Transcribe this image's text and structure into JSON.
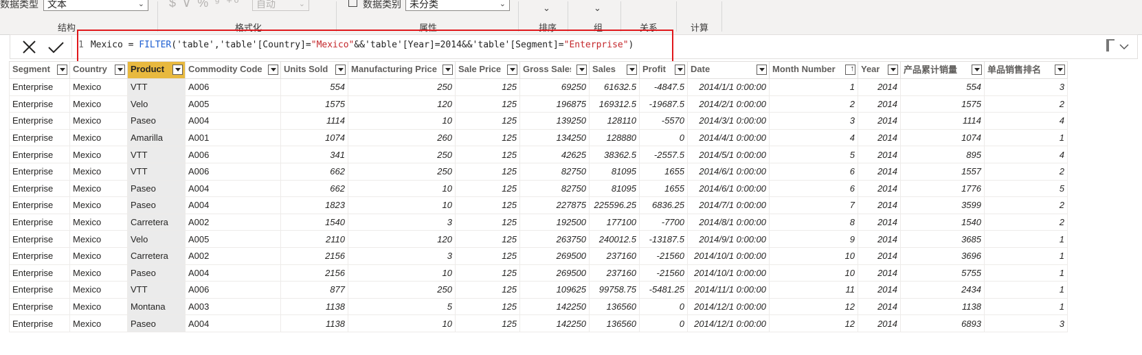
{
  "ribbon": {
    "data_type_label": "数据类型",
    "data_type_value": "文本",
    "group_structure": "结构",
    "format_symbols": "$ ∨ % ⁹ ⁺⁰",
    "format_select_value": "自动",
    "group_format": "格式化",
    "data_category_label": "数据类别",
    "data_category_value": "未分类",
    "group_properties": "属性",
    "group_sort": "排序",
    "group_group": "组",
    "group_relationships": "关系",
    "group_calculations": "计算"
  },
  "formula_bar": {
    "line_number": "1",
    "p1": "Mexico = ",
    "fn": "FILTER",
    "p2": "('table','table'[Country]=",
    "s1": "\"Mexico\"",
    "p3": "&&'table'[Year]=2014&&'table'[Segment]=",
    "s2": "\"Enterprise\"",
    "p4": ")"
  },
  "table": {
    "columns": [
      "Segment",
      "Country",
      "Product",
      "Commodity Code",
      "Units Sold",
      "Manufacturing Price",
      "Sale Price",
      "Gross Sales",
      "Sales",
      "Profit",
      "Date",
      "Month Number",
      "Year",
      "产品累计销量",
      "单品销售排名"
    ],
    "rows": [
      [
        "Enterprise",
        "Mexico",
        "VTT",
        "A006",
        "554",
        "250",
        "125",
        "69250",
        "61632.5",
        "-4847.5",
        "2014/1/1 0:00:00",
        "1",
        "2014",
        "554",
        "3"
      ],
      [
        "Enterprise",
        "Mexico",
        "Velo",
        "A005",
        "1575",
        "120",
        "125",
        "196875",
        "169312.5",
        "-19687.5",
        "2014/2/1 0:00:00",
        "2",
        "2014",
        "1575",
        "2"
      ],
      [
        "Enterprise",
        "Mexico",
        "Paseo",
        "A004",
        "1114",
        "10",
        "125",
        "139250",
        "128110",
        "-5570",
        "2014/3/1 0:00:00",
        "3",
        "2014",
        "1114",
        "4"
      ],
      [
        "Enterprise",
        "Mexico",
        "Amarilla",
        "A001",
        "1074",
        "260",
        "125",
        "134250",
        "128880",
        "0",
        "2014/4/1 0:00:00",
        "4",
        "2014",
        "1074",
        "1"
      ],
      [
        "Enterprise",
        "Mexico",
        "VTT",
        "A006",
        "341",
        "250",
        "125",
        "42625",
        "38362.5",
        "-2557.5",
        "2014/5/1 0:00:00",
        "5",
        "2014",
        "895",
        "4"
      ],
      [
        "Enterprise",
        "Mexico",
        "VTT",
        "A006",
        "662",
        "250",
        "125",
        "82750",
        "81095",
        "1655",
        "2014/6/1 0:00:00",
        "6",
        "2014",
        "1557",
        "2"
      ],
      [
        "Enterprise",
        "Mexico",
        "Paseo",
        "A004",
        "662",
        "10",
        "125",
        "82750",
        "81095",
        "1655",
        "2014/6/1 0:00:00",
        "6",
        "2014",
        "1776",
        "5"
      ],
      [
        "Enterprise",
        "Mexico",
        "Paseo",
        "A004",
        "1823",
        "10",
        "125",
        "227875",
        "225596.25",
        "6836.25",
        "2014/7/1 0:00:00",
        "7",
        "2014",
        "3599",
        "2"
      ],
      [
        "Enterprise",
        "Mexico",
        "Carretera",
        "A002",
        "1540",
        "3",
        "125",
        "192500",
        "177100",
        "-7700",
        "2014/8/1 0:00:00",
        "8",
        "2014",
        "1540",
        "2"
      ],
      [
        "Enterprise",
        "Mexico",
        "Velo",
        "A005",
        "2110",
        "120",
        "125",
        "263750",
        "240012.5",
        "-13187.5",
        "2014/9/1 0:00:00",
        "9",
        "2014",
        "3685",
        "1"
      ],
      [
        "Enterprise",
        "Mexico",
        "Carretera",
        "A002",
        "2156",
        "3",
        "125",
        "269500",
        "237160",
        "-21560",
        "2014/10/1 0:00:00",
        "10",
        "2014",
        "3696",
        "1"
      ],
      [
        "Enterprise",
        "Mexico",
        "Paseo",
        "A004",
        "2156",
        "10",
        "125",
        "269500",
        "237160",
        "-21560",
        "2014/10/1 0:00:00",
        "10",
        "2014",
        "5755",
        "1"
      ],
      [
        "Enterprise",
        "Mexico",
        "VTT",
        "A006",
        "877",
        "250",
        "125",
        "109625",
        "99758.75",
        "-5481.25",
        "2014/11/1 0:00:00",
        "11",
        "2014",
        "2434",
        "1"
      ],
      [
        "Enterprise",
        "Mexico",
        "Montana",
        "A003",
        "1138",
        "5",
        "125",
        "142250",
        "136560",
        "0",
        "2014/12/1 0:00:00",
        "12",
        "2014",
        "1138",
        "1"
      ],
      [
        "Enterprise",
        "Mexico",
        "Paseo",
        "A004",
        "1138",
        "10",
        "125",
        "142250",
        "136560",
        "0",
        "2014/12/1 0:00:00",
        "12",
        "2014",
        "6893",
        "3"
      ]
    ]
  },
  "colors": {
    "selected_header": "#e8b93f",
    "formula_function": "#1d5fd1",
    "formula_string": "#c4272b",
    "highlight_box": "#e0161a"
  }
}
